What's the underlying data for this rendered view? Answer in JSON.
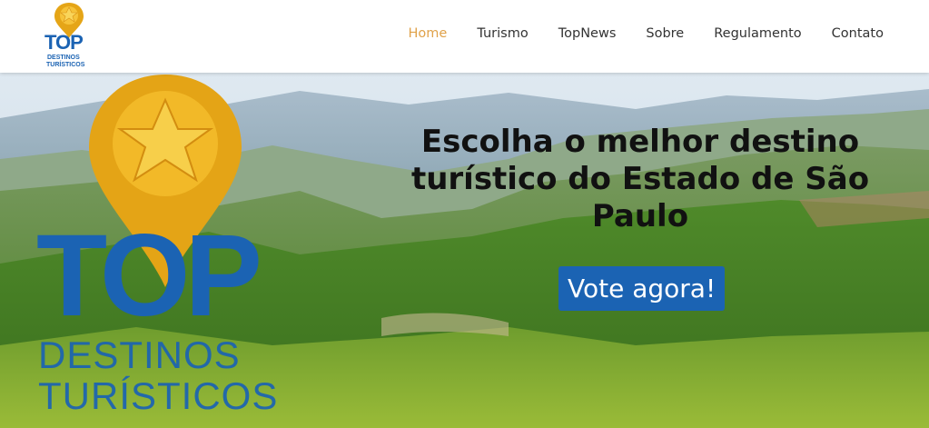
{
  "logo": {
    "top_word": "TOP",
    "line1": "DESTINOS",
    "line2": "TURÍSTICOS"
  },
  "nav": {
    "items": [
      {
        "label": "Home",
        "active": true
      },
      {
        "label": "Turismo",
        "active": false
      },
      {
        "label": "TopNews",
        "active": false
      },
      {
        "label": "Sobre",
        "active": false
      },
      {
        "label": "Regulamento",
        "active": false
      },
      {
        "label": "Contato",
        "active": false
      }
    ]
  },
  "hero": {
    "headline_line1": "Escolha o melhor destino",
    "headline_line2": "turístico do Estado de São",
    "headline_line3": "Paulo",
    "cta": "Vote agora!"
  },
  "colors": {
    "brand_blue": "#1b63b3",
    "accent_gold": "#e0a24a",
    "nav_text": "#333333"
  }
}
